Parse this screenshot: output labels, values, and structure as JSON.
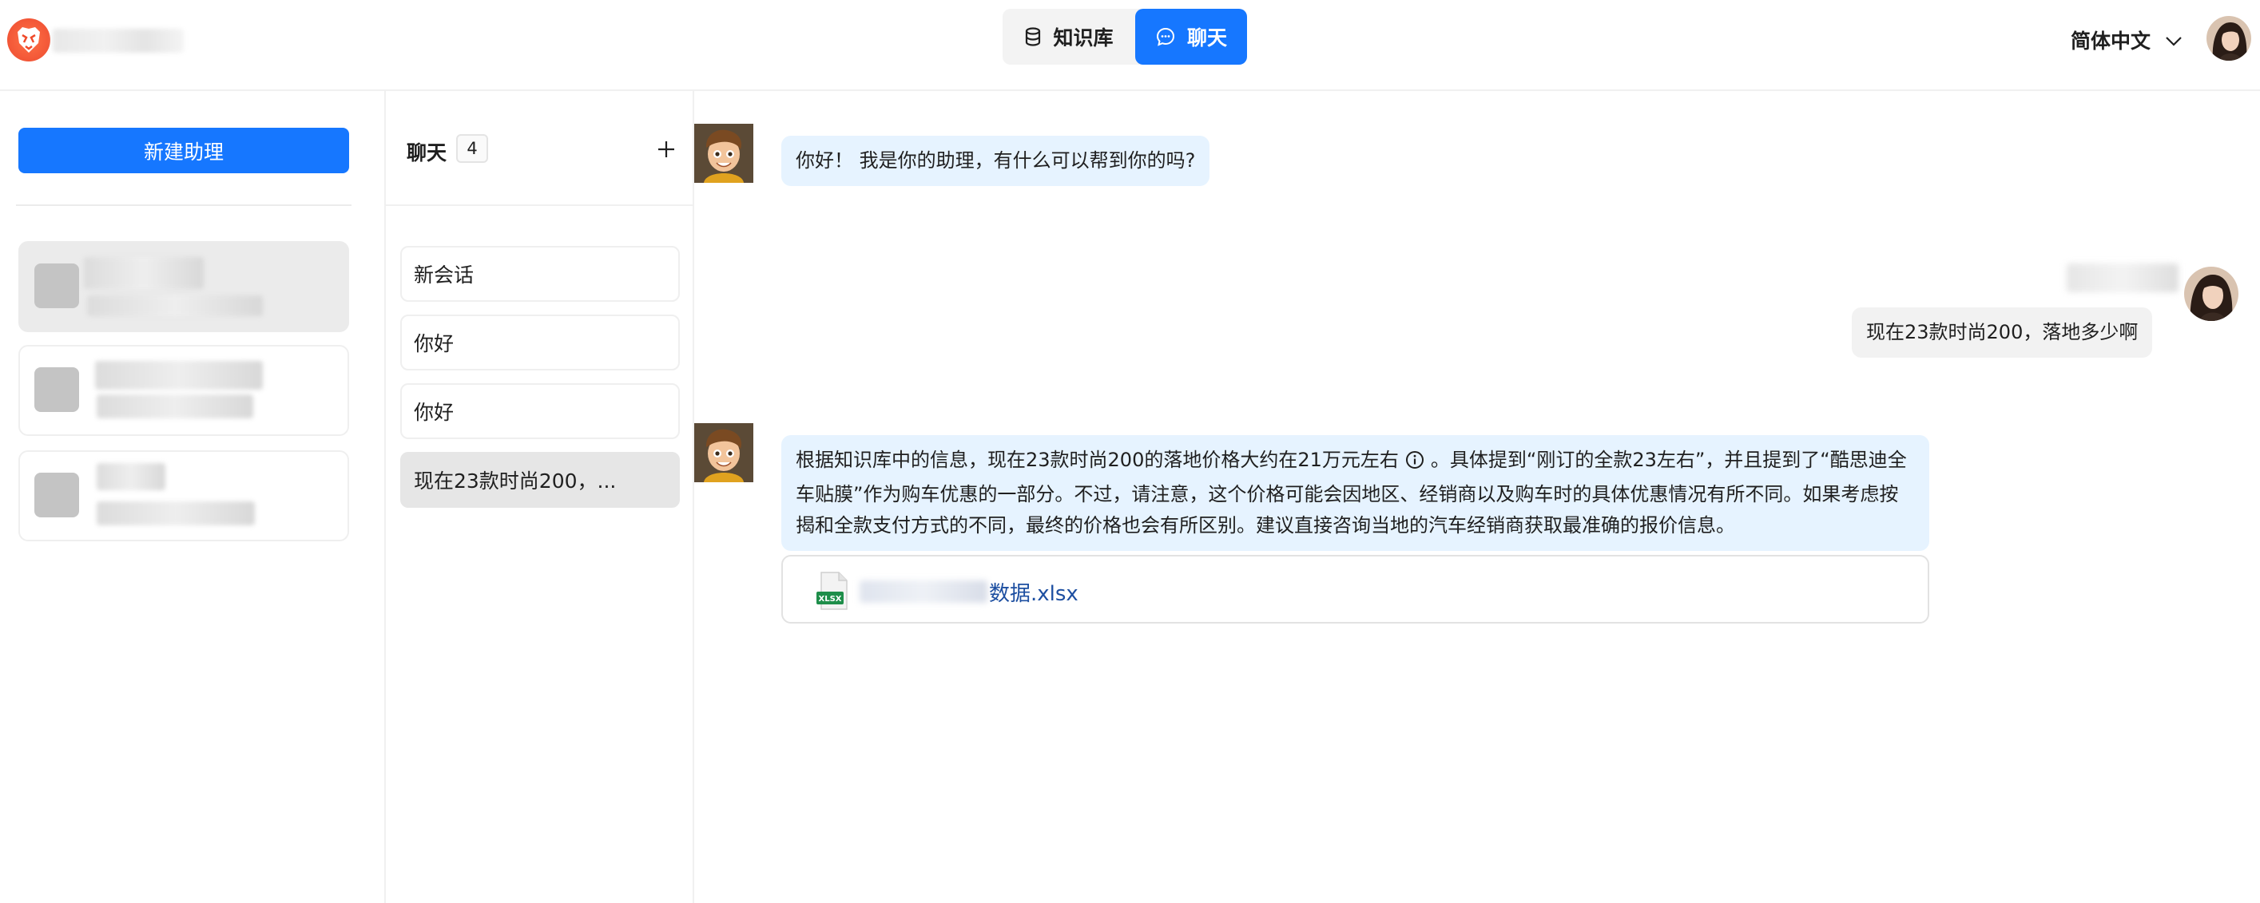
{
  "header": {
    "nav": {
      "knowledge_base": "知识库",
      "chat": "聊天"
    },
    "language": "简体中文"
  },
  "assistants": {
    "new_button": "新建助理"
  },
  "conversations": {
    "title": "聊天",
    "count": "4",
    "items": [
      {
        "label": "新会话"
      },
      {
        "label": "你好"
      },
      {
        "label": "你好"
      },
      {
        "label": "现在23款时尚200，..."
      }
    ]
  },
  "chat": {
    "messages": [
      {
        "role": "assistant",
        "text": "你好！ 我是你的助理，有什么可以帮到你的吗?"
      },
      {
        "role": "user",
        "text": "现在23款时尚200，落地多少啊"
      },
      {
        "role": "assistant",
        "text_before_info": "根据知识库中的信息，现在23款时尚200的落地价格大约在21万元左右",
        "text_after_info": "。具体提到“刚订的全款23左右”，并且提到了“酷思迪全车贴膜”作为购车优惠的一部分。不过，请注意，这个价格可能会因地区、经销商以及购车时的具体优惠情况有所不同。如果考虑按揭和全款支付方式的不同，最终的价格也会有所区别。建议直接咨询当地的汽车经销商获取最准确的报价信息。"
      }
    ],
    "attachment": {
      "visible_name": "数据.xlsx",
      "icon_label": "XLSX",
      "icon": "excel-file-icon"
    }
  },
  "colors": {
    "primary": "#1677ff",
    "bot_bubble": "#e6f3ff",
    "user_bubble": "#f2f2f2",
    "file_link": "#1d4fa1"
  }
}
